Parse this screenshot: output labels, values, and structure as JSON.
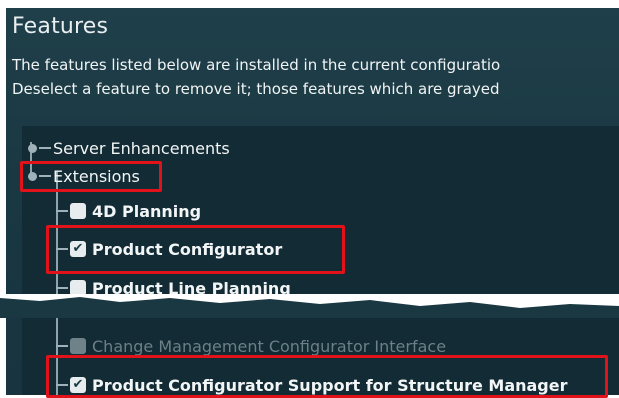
{
  "dialog": {
    "title": "Features",
    "description_line1": "The features listed below are installed in the current configuratio",
    "description_line2": "Deselect a feature to remove it; those features which are grayed"
  },
  "tree": {
    "top_items": [
      {
        "label": "Server Enhancements"
      },
      {
        "label": "Extensions"
      }
    ],
    "children": [
      {
        "label": "4D Planning",
        "checked": false,
        "disabled": false
      },
      {
        "label": "Product Configurator",
        "checked": true,
        "disabled": false
      },
      {
        "label": "Product Line Planning",
        "checked": false,
        "disabled": false
      },
      {
        "label": "Change Management Configurator Interface",
        "checked": false,
        "disabled": true
      },
      {
        "label": "Product Configurator Support for Structure Manager",
        "checked": true,
        "disabled": false
      }
    ]
  },
  "colors": {
    "highlight": "#e2121a",
    "panel_background": "#1a3842"
  },
  "icons": {
    "checked": "✔",
    "expander": "tree-expander-icon"
  }
}
